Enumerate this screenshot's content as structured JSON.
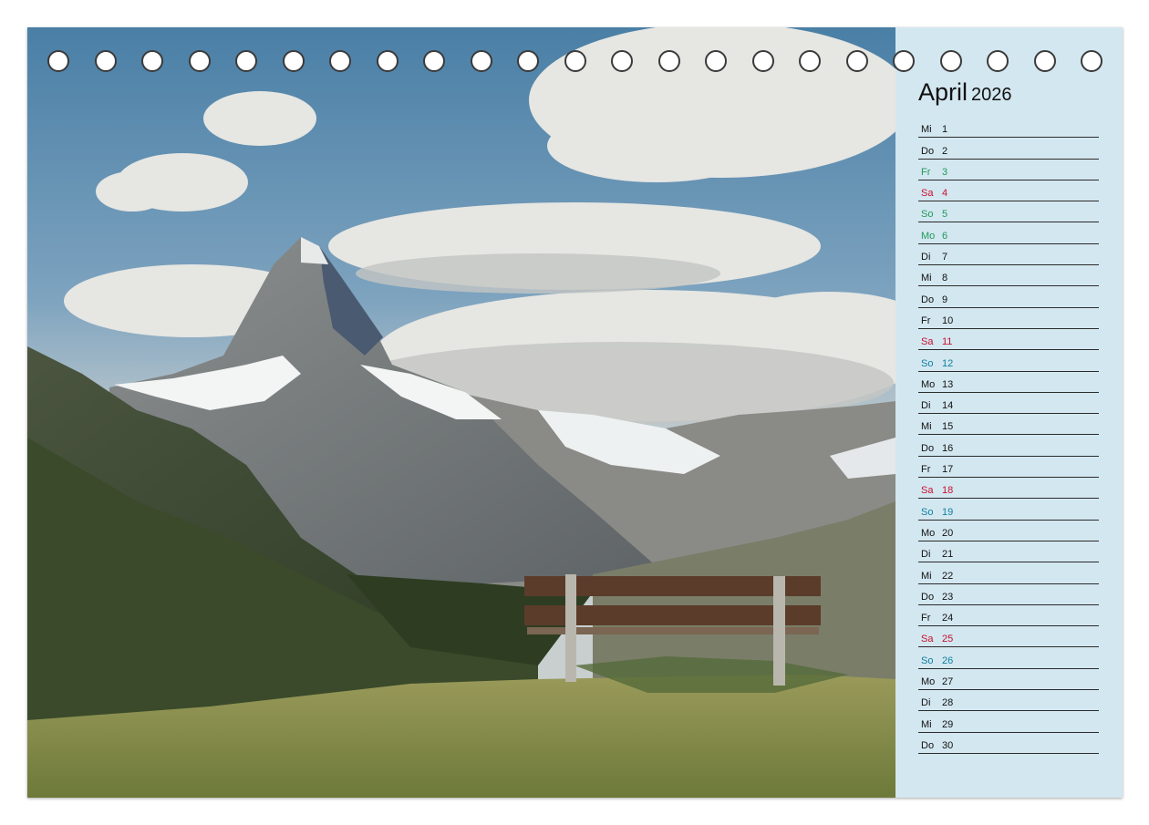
{
  "calendar": {
    "month": "April",
    "year": "2026",
    "days": [
      {
        "wd": "Mi",
        "d": "1",
        "kind": "normal"
      },
      {
        "wd": "Do",
        "d": "2",
        "kind": "normal"
      },
      {
        "wd": "Fr",
        "d": "3",
        "kind": "holiday"
      },
      {
        "wd": "Sa",
        "d": "4",
        "kind": "saturday"
      },
      {
        "wd": "So",
        "d": "5",
        "kind": "holiday"
      },
      {
        "wd": "Mo",
        "d": "6",
        "kind": "holiday"
      },
      {
        "wd": "Di",
        "d": "7",
        "kind": "normal"
      },
      {
        "wd": "Mi",
        "d": "8",
        "kind": "normal"
      },
      {
        "wd": "Do",
        "d": "9",
        "kind": "normal"
      },
      {
        "wd": "Fr",
        "d": "10",
        "kind": "normal"
      },
      {
        "wd": "Sa",
        "d": "11",
        "kind": "saturday"
      },
      {
        "wd": "So",
        "d": "12",
        "kind": "sunday"
      },
      {
        "wd": "Mo",
        "d": "13",
        "kind": "normal"
      },
      {
        "wd": "Di",
        "d": "14",
        "kind": "normal"
      },
      {
        "wd": "Mi",
        "d": "15",
        "kind": "normal"
      },
      {
        "wd": "Do",
        "d": "16",
        "kind": "normal"
      },
      {
        "wd": "Fr",
        "d": "17",
        "kind": "normal"
      },
      {
        "wd": "Sa",
        "d": "18",
        "kind": "saturday"
      },
      {
        "wd": "So",
        "d": "19",
        "kind": "sunday"
      },
      {
        "wd": "Mo",
        "d": "20",
        "kind": "normal"
      },
      {
        "wd": "Di",
        "d": "21",
        "kind": "normal"
      },
      {
        "wd": "Mi",
        "d": "22",
        "kind": "normal"
      },
      {
        "wd": "Do",
        "d": "23",
        "kind": "normal"
      },
      {
        "wd": "Fr",
        "d": "24",
        "kind": "normal"
      },
      {
        "wd": "Sa",
        "d": "25",
        "kind": "saturday"
      },
      {
        "wd": "So",
        "d": "26",
        "kind": "sunday"
      },
      {
        "wd": "Mo",
        "d": "27",
        "kind": "normal"
      },
      {
        "wd": "Di",
        "d": "28",
        "kind": "normal"
      },
      {
        "wd": "Mi",
        "d": "29",
        "kind": "normal"
      },
      {
        "wd": "Do",
        "d": "30",
        "kind": "normal"
      }
    ]
  },
  "colors": {
    "panel": "#d3e7f0",
    "saturday": "#c8102e",
    "sunday": "#0f7fa0",
    "holiday": "#1f9a5a"
  },
  "binding": {
    "hole_count": 23
  }
}
